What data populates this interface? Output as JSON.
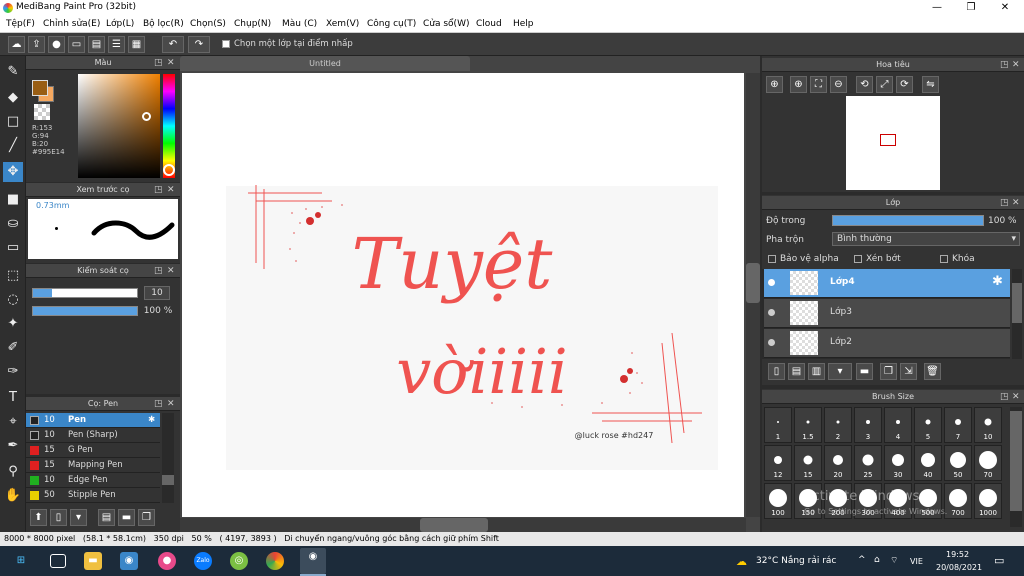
{
  "app": {
    "title": "MediBang Paint Pro (32bit)"
  },
  "window_controls": {
    "minimize": "—",
    "maximize": "❐",
    "close": "✕"
  },
  "menu": [
    "Tệp(F)",
    "Chỉnh sửa(E)",
    "Lớp(L)",
    "Bộ lọc(R)",
    "Chọn(S)",
    "Chụp(N)",
    "Màu (C)",
    "Xem(V)",
    "Công cụ(T)",
    "Cửa sổ(W)",
    "Cloud",
    "Help"
  ],
  "toolbar": {
    "checkbox_label": "Chọn một lớp tại điểm nhấp",
    "icons": [
      "cloud-icon",
      "upload-icon",
      "comment-icon",
      "message-icon",
      "document-icon",
      "list-icon",
      "grid-icon",
      "undo-icon",
      "redo-icon"
    ]
  },
  "color_panel": {
    "title": "Màu",
    "r": "R:153",
    "g": "G:94",
    "b": "B:20",
    "hex": "#995E14",
    "fg_color": "#995E14",
    "bg_color": "#f5a860"
  },
  "brush_preview": {
    "title": "Xem trước cọ",
    "size": "0.73mm"
  },
  "brush_control": {
    "title": "Kiểm soát cọ",
    "size": "10",
    "opacity": "100 %"
  },
  "brush_list": {
    "title": "Cọ: Pen",
    "items": [
      {
        "size": "10",
        "name": "Pen",
        "color": "#222222",
        "selected": true
      },
      {
        "size": "10",
        "name": "Pen (Sharp)",
        "color": "#222222"
      },
      {
        "size": "15",
        "name": "G Pen",
        "color": "#e02020"
      },
      {
        "size": "15",
        "name": "Mapping Pen",
        "color": "#e02020"
      },
      {
        "size": "10",
        "name": "Edge Pen",
        "color": "#20b020"
      },
      {
        "size": "50",
        "name": "Stipple Pen",
        "color": "#e8d000"
      }
    ]
  },
  "document": {
    "tab": "Untitled"
  },
  "artwork": {
    "line1": "Tuyệt",
    "line2": "vờiiiii",
    "credit": "@luck rose #hd247",
    "color": "#ef5350"
  },
  "navigator": {
    "title": "Hoa tiêu"
  },
  "layers": {
    "title": "Lớp",
    "opacity_label": "Độ trong",
    "opacity_value": "100 %",
    "blend_label": "Pha trộn",
    "blend_value": "Bình thường",
    "protect_alpha": "Bảo vệ alpha",
    "clip": "Xén bớt",
    "lock": "Khóa",
    "items": [
      {
        "name": "Lớp4",
        "selected": true
      },
      {
        "name": "Lớp3"
      },
      {
        "name": "Lớp2"
      }
    ]
  },
  "brush_size": {
    "title": "Brush Size",
    "values": [
      "1",
      "1.5",
      "2",
      "3",
      "4",
      "5",
      "7",
      "10",
      "12",
      "15",
      "20",
      "25",
      "30",
      "40",
      "50",
      "70",
      "100",
      "150",
      "200",
      "300",
      "400",
      "500",
      "700",
      "1000"
    ],
    "watermark1": "Activate Windows",
    "watermark2": "Go to Settings to activate Windows."
  },
  "status": {
    "text": "8000 * 8000 pixel   (58.1 * 58.1cm)   350 dpi   50 %   ( 4197, 3893 )   Di chuyển ngang/vuông góc bằng cách giữ phím Shift"
  },
  "taskbar": {
    "weather": "32°C  Nắng rải rác",
    "lang": "VIE",
    "time": "19:52",
    "date": "20/08/2021"
  }
}
